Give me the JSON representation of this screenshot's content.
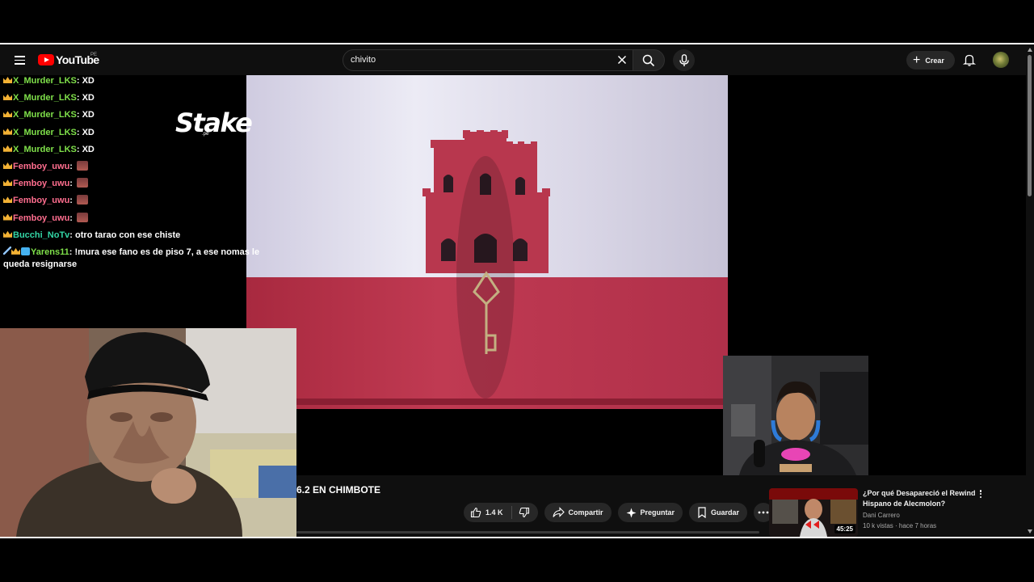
{
  "header": {
    "logo_text": "YouTube",
    "country_code": "PE",
    "search_value": "chivito",
    "create_label": "Crear"
  },
  "overlay": {
    "sponsor_logo": "Stake",
    "sponsor_sub": ".pe"
  },
  "chat": [
    {
      "badges": [
        "crown"
      ],
      "user": "X_Murder_LKS",
      "color": "green",
      "message": "XD",
      "emote": false
    },
    {
      "badges": [
        "crown"
      ],
      "user": "X_Murder_LKS",
      "color": "green",
      "message": "XD",
      "emote": false
    },
    {
      "badges": [
        "crown"
      ],
      "user": "X_Murder_LKS",
      "color": "green",
      "message": "XD",
      "emote": false
    },
    {
      "badges": [
        "crown"
      ],
      "user": "X_Murder_LKS",
      "color": "green",
      "message": "XD",
      "emote": false
    },
    {
      "badges": [
        "crown"
      ],
      "user": "X_Murder_LKS",
      "color": "green",
      "message": "XD",
      "emote": false
    },
    {
      "badges": [
        "crown"
      ],
      "user": "Femboy_uwu",
      "color": "pink",
      "message": "",
      "emote": true
    },
    {
      "badges": [
        "crown"
      ],
      "user": "Femboy_uwu",
      "color": "pink",
      "message": "",
      "emote": true
    },
    {
      "badges": [
        "crown"
      ],
      "user": "Femboy_uwu",
      "color": "pink",
      "message": "",
      "emote": true
    },
    {
      "badges": [
        "crown"
      ],
      "user": "Femboy_uwu",
      "color": "pink",
      "message": "",
      "emote": true
    },
    {
      "badges": [
        "crown"
      ],
      "user": "Bucchi_NoTv",
      "color": "teal",
      "message": "otro tarao con ese chiste",
      "emote": false
    },
    {
      "badges": [
        "sword",
        "crown",
        "square"
      ],
      "user": "Yarens11",
      "color": "green",
      "message": "!mura ese fano es de piso 7, a ese nomas le queda resignarse",
      "emote": false
    }
  ],
  "video": {
    "title": "6.2 EN CHIMBOTE",
    "likes": "1.4 K",
    "share_label": "Compartir",
    "ask_label": "Preguntar",
    "save_label": "Guardar"
  },
  "recommendation": {
    "title": "¿Por qué Desapareció el Rewind Hispano de Alecmolon?",
    "channel": "Dani Carrero",
    "meta": "10 k vistas · hace 7 horas",
    "duration": "45:25"
  },
  "colors": {
    "brand_red": "#ff0000",
    "background": "#0f0f0f",
    "pill": "#272727",
    "chat_green": "#7fe04a",
    "chat_pink": "#ff6e8f",
    "chat_teal": "#33d6a6",
    "flag_red": "#b5304a"
  }
}
